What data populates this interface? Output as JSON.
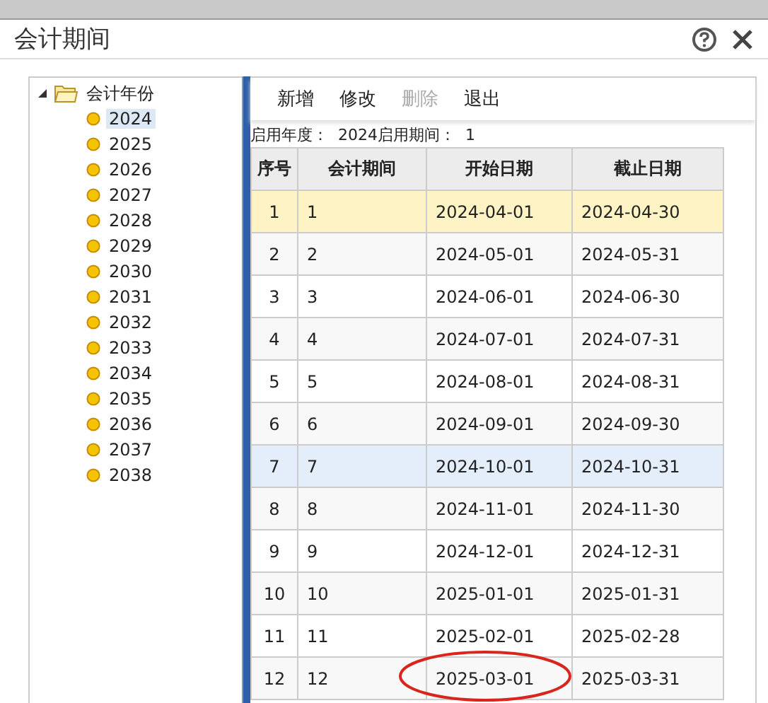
{
  "window": {
    "title": "会计期间"
  },
  "tree": {
    "label": "会计年份",
    "expanded": true,
    "children": [
      {
        "label": "2024",
        "selected": true
      },
      {
        "label": "2025",
        "selected": false
      },
      {
        "label": "2026",
        "selected": false
      },
      {
        "label": "2027",
        "selected": false
      },
      {
        "label": "2028",
        "selected": false
      },
      {
        "label": "2029",
        "selected": false
      },
      {
        "label": "2030",
        "selected": false
      },
      {
        "label": "2031",
        "selected": false
      },
      {
        "label": "2032",
        "selected": false
      },
      {
        "label": "2033",
        "selected": false
      },
      {
        "label": "2034",
        "selected": false
      },
      {
        "label": "2035",
        "selected": false
      },
      {
        "label": "2036",
        "selected": false
      },
      {
        "label": "2037",
        "selected": false
      },
      {
        "label": "2038",
        "selected": false
      }
    ]
  },
  "toolbar": [
    {
      "label": "新增",
      "disabled": false
    },
    {
      "label": "修改",
      "disabled": false
    },
    {
      "label": "删除",
      "disabled": true
    },
    {
      "label": "退出",
      "disabled": false
    }
  ],
  "info": "启用年度：  2024启用期间：  1",
  "table": {
    "columns": [
      "序号",
      "会计期间",
      "开始日期",
      "截止日期"
    ],
    "rows": [
      {
        "cells": [
          "1",
          "1",
          "2024-04-01",
          "2024-04-30"
        ],
        "selected": true,
        "hovered": false
      },
      {
        "cells": [
          "2",
          "2",
          "2024-05-01",
          "2024-05-31"
        ],
        "selected": false,
        "hovered": false
      },
      {
        "cells": [
          "3",
          "3",
          "2024-06-01",
          "2024-06-30"
        ],
        "selected": false,
        "hovered": false
      },
      {
        "cells": [
          "4",
          "4",
          "2024-07-01",
          "2024-07-31"
        ],
        "selected": false,
        "hovered": false
      },
      {
        "cells": [
          "5",
          "5",
          "2024-08-01",
          "2024-08-31"
        ],
        "selected": false,
        "hovered": false
      },
      {
        "cells": [
          "6",
          "6",
          "2024-09-01",
          "2024-09-30"
        ],
        "selected": false,
        "hovered": false
      },
      {
        "cells": [
          "7",
          "7",
          "2024-10-01",
          "2024-10-31"
        ],
        "selected": false,
        "hovered": true
      },
      {
        "cells": [
          "8",
          "8",
          "2024-11-01",
          "2024-11-30"
        ],
        "selected": false,
        "hovered": false
      },
      {
        "cells": [
          "9",
          "9",
          "2024-12-01",
          "2024-12-31"
        ],
        "selected": false,
        "hovered": false
      },
      {
        "cells": [
          "10",
          "10",
          "2025-01-01",
          "2025-01-31"
        ],
        "selected": false,
        "hovered": false
      },
      {
        "cells": [
          "11",
          "11",
          "2025-02-01",
          "2025-02-28"
        ],
        "selected": false,
        "hovered": false
      },
      {
        "cells": [
          "12",
          "12",
          "2025-03-01",
          "2025-03-31"
        ],
        "selected": false,
        "hovered": false
      }
    ]
  }
}
